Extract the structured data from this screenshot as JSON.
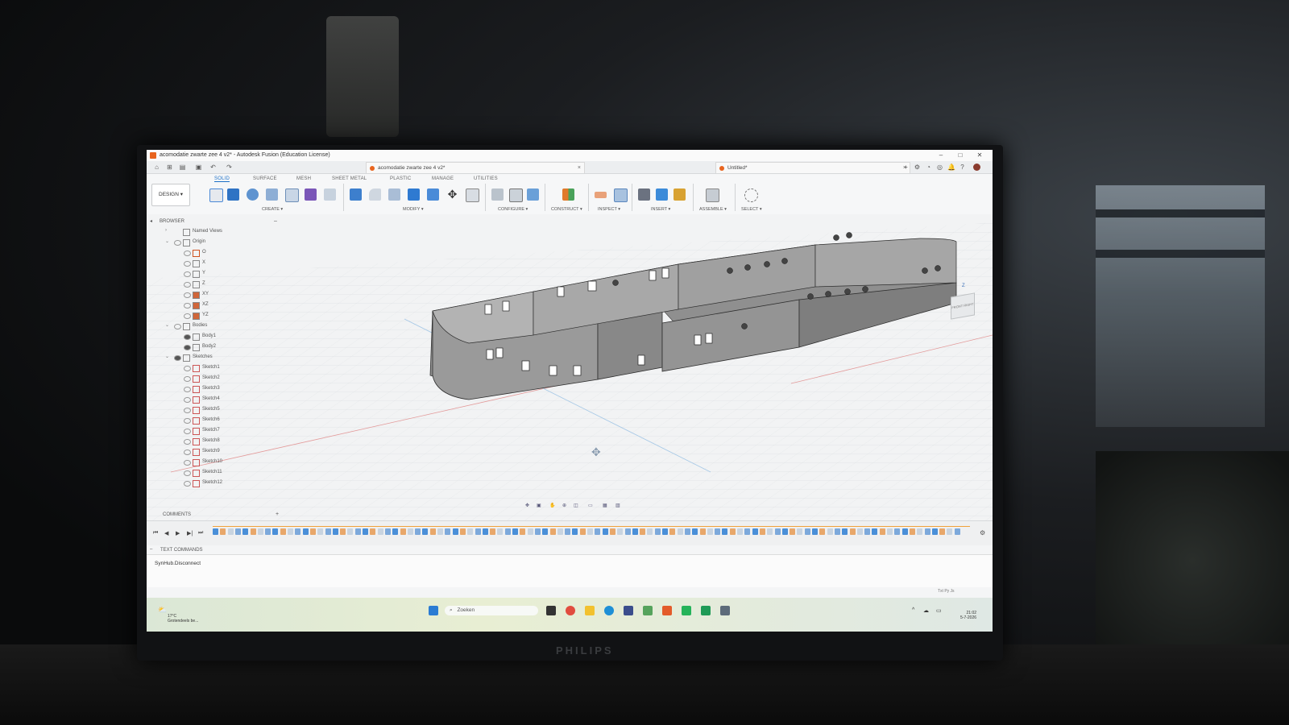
{
  "window": {
    "title": "acomodatie zwarte zee 4 v2* - Autodesk Fusion (Education License)",
    "minimize": "–",
    "maximize": "□",
    "close": "✕"
  },
  "tabs": [
    {
      "label": "acomodatie zwarte zee 4 v2*",
      "close": "×"
    },
    {
      "label": "Untitled*",
      "close": "×"
    }
  ],
  "ribbon": {
    "workspace": "DESIGN ▾",
    "tabs": [
      "SOLID",
      "SURFACE",
      "MESH",
      "SHEET METAL",
      "PLASTIC",
      "MANAGE",
      "UTILITIES"
    ],
    "groups": [
      "CREATE ▾",
      "MODIFY ▾",
      "CONFIGURE ▾",
      "CONSTRUCT ▾",
      "INSPECT ▾",
      "INSERT ▾",
      "ASSEMBLE ▾",
      "SELECT ▾"
    ]
  },
  "browser": {
    "title": "BROWSER",
    "collapse": "–",
    "items": [
      {
        "label": "Named Views",
        "caret": "›"
      },
      {
        "label": "Origin",
        "caret": "⌄"
      },
      {
        "label": "O"
      },
      {
        "label": "X"
      },
      {
        "label": "Y"
      },
      {
        "label": "Z"
      },
      {
        "label": "XY"
      },
      {
        "label": "XZ"
      },
      {
        "label": "YZ"
      },
      {
        "label": "Bodies",
        "caret": "⌄"
      },
      {
        "label": "Body1"
      },
      {
        "label": "Body2"
      },
      {
        "label": "Sketches",
        "caret": "⌄"
      },
      {
        "label": "Sketch1"
      },
      {
        "label": "Sketch2"
      },
      {
        "label": "Sketch3"
      },
      {
        "label": "Sketch4"
      },
      {
        "label": "Sketch5"
      },
      {
        "label": "Sketch6"
      },
      {
        "label": "Sketch7"
      },
      {
        "label": "Sketch8"
      },
      {
        "label": "Sketch9"
      },
      {
        "label": "Sketch10"
      },
      {
        "label": "Sketch11"
      },
      {
        "label": "Sketch12"
      }
    ]
  },
  "viewcube": {
    "front": "FRONT",
    "right": "RIGHT",
    "axis": "Z"
  },
  "comments": {
    "title": "COMMENTS",
    "add": "+"
  },
  "timeline": {
    "controls": [
      "⏮",
      "◀",
      "▶",
      "▶|",
      "⏭"
    ]
  },
  "text_commands": {
    "title": "TEXT COMMANDS",
    "entry": "SynHub.Disconnect",
    "modes": "Txt  Py  Js"
  },
  "taskbar": {
    "weather_temp": "17°C",
    "weather_desc": "Grotendeels be...",
    "search_placeholder": "Zoeken",
    "time": "21:02",
    "date": "5-7-2026"
  },
  "monitor_brand": "PHILIPS",
  "colors": {
    "accent": "#1c6fc7",
    "timeline_marker": "#f0a23a",
    "fusion_orange": "#e8641e"
  }
}
